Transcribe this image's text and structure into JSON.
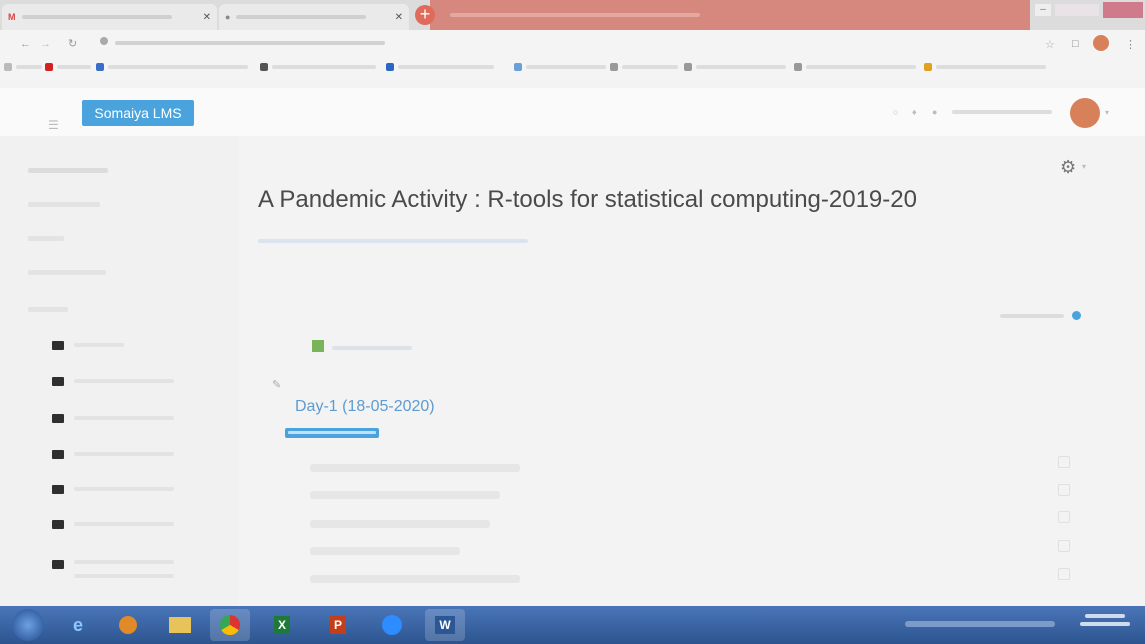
{
  "app": {
    "brand": "Somaiya LMS",
    "page_title": "A Pandemic Activity : R-tools for statistical computing-2019-20"
  },
  "course": {
    "day1_title": "Day-1 (18-05-2020)"
  },
  "colors": {
    "brand_blue": "#4aa3dd",
    "taskbar_blue": "#2c558f",
    "link_blue": "#5e9bd1",
    "tab_red": "#d6887e"
  },
  "icons": {
    "settings": "gear-icon",
    "folder": "folder-icon",
    "announcements": "forum-icon",
    "edit": "pencil-icon"
  }
}
